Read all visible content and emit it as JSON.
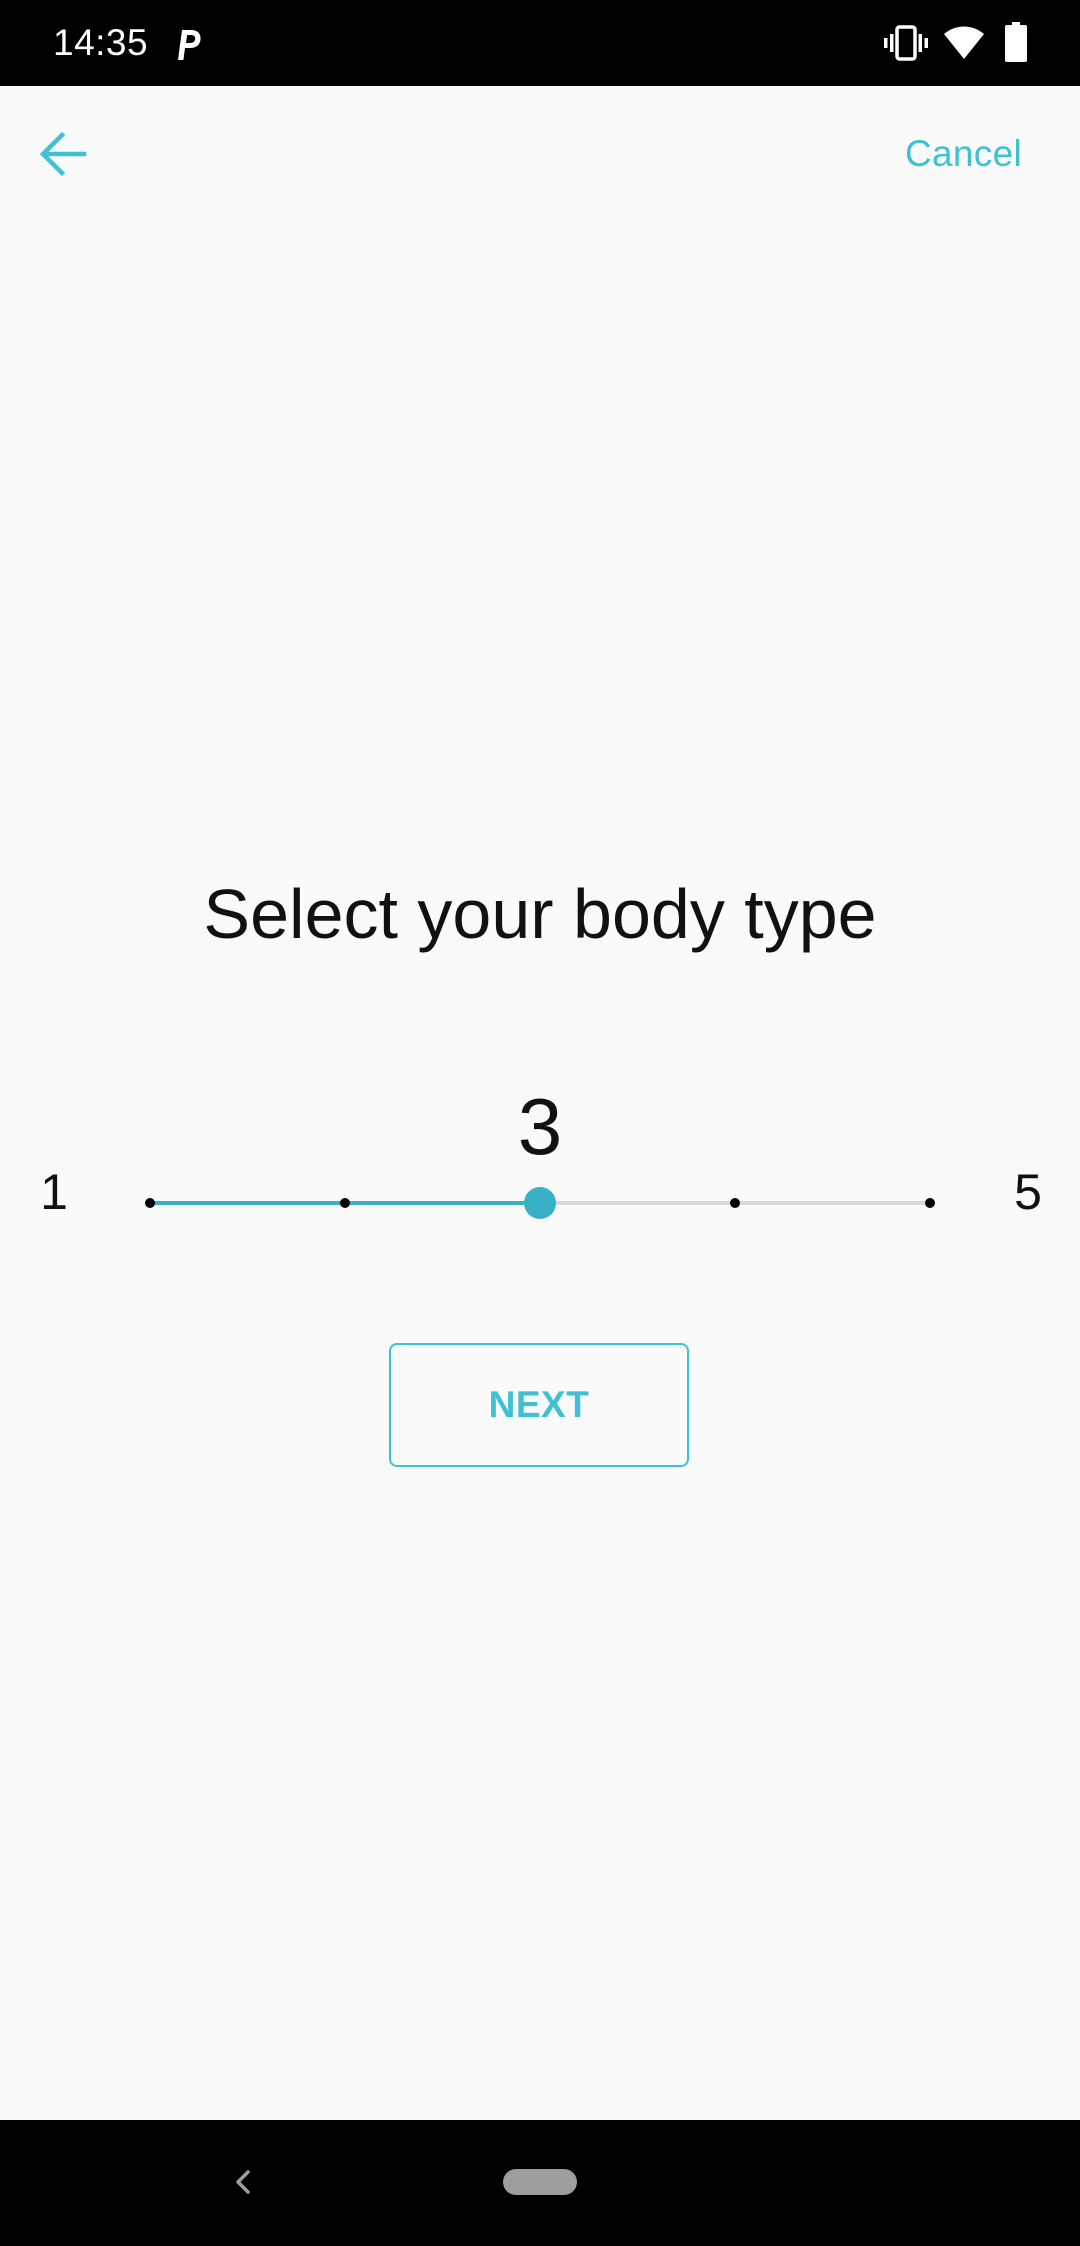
{
  "status_bar": {
    "time": "14:35",
    "icons": [
      "parking-app-icon",
      "vibrate-icon",
      "wifi-icon",
      "battery-icon"
    ]
  },
  "app_bar": {
    "back_icon": "arrow-left-icon",
    "cancel_label": "Cancel"
  },
  "main": {
    "title": "Select your body type",
    "slider": {
      "value": "3",
      "min": "1",
      "max": "5",
      "steps": [
        1,
        2,
        3,
        4,
        5
      ],
      "current": 3
    },
    "next_label": "NEXT"
  },
  "nav_bar": {
    "back_icon": "chevron-left-icon",
    "home_icon": "home-pill-icon"
  },
  "colors": {
    "accent": "#3EC1D3",
    "slider_active": "#3AB0C6",
    "slider_inactive": "#DADADA",
    "background": "#FAFAFA",
    "text": "#111111"
  }
}
